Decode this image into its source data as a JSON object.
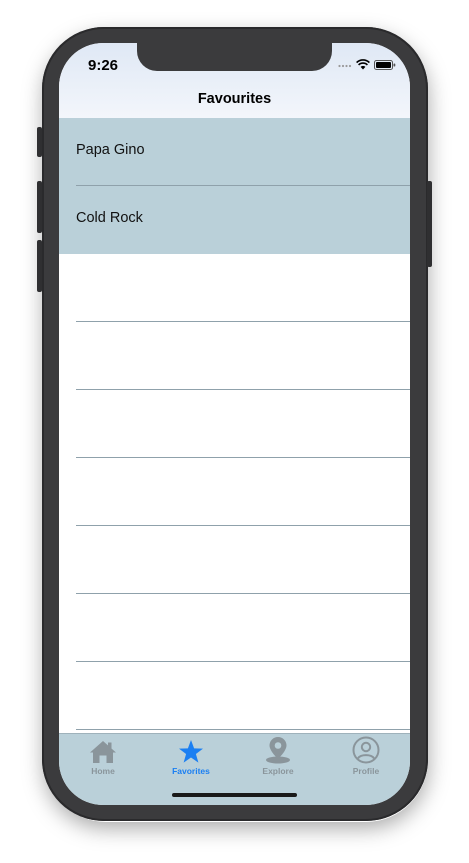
{
  "status_bar": {
    "time": "9:26"
  },
  "header": {
    "title": "Favourites"
  },
  "list": {
    "items": [
      {
        "label": "Papa Gino"
      },
      {
        "label": "Cold Rock"
      }
    ]
  },
  "tab_bar": {
    "active_color": "#1b7ff2",
    "inactive_color": "#8a959b",
    "tabs": [
      {
        "label": "Home",
        "icon": "house-icon"
      },
      {
        "label": "Favorites",
        "icon": "star-icon"
      },
      {
        "label": "Explore",
        "icon": "map-pin-icon"
      },
      {
        "label": "Profile",
        "icon": "person-circle-icon"
      }
    ]
  },
  "colors": {
    "row_background": "#bad0d9",
    "tab_bar_background": "#bad0d9",
    "nav_bar_gradient_top": "#dfe8f5"
  }
}
